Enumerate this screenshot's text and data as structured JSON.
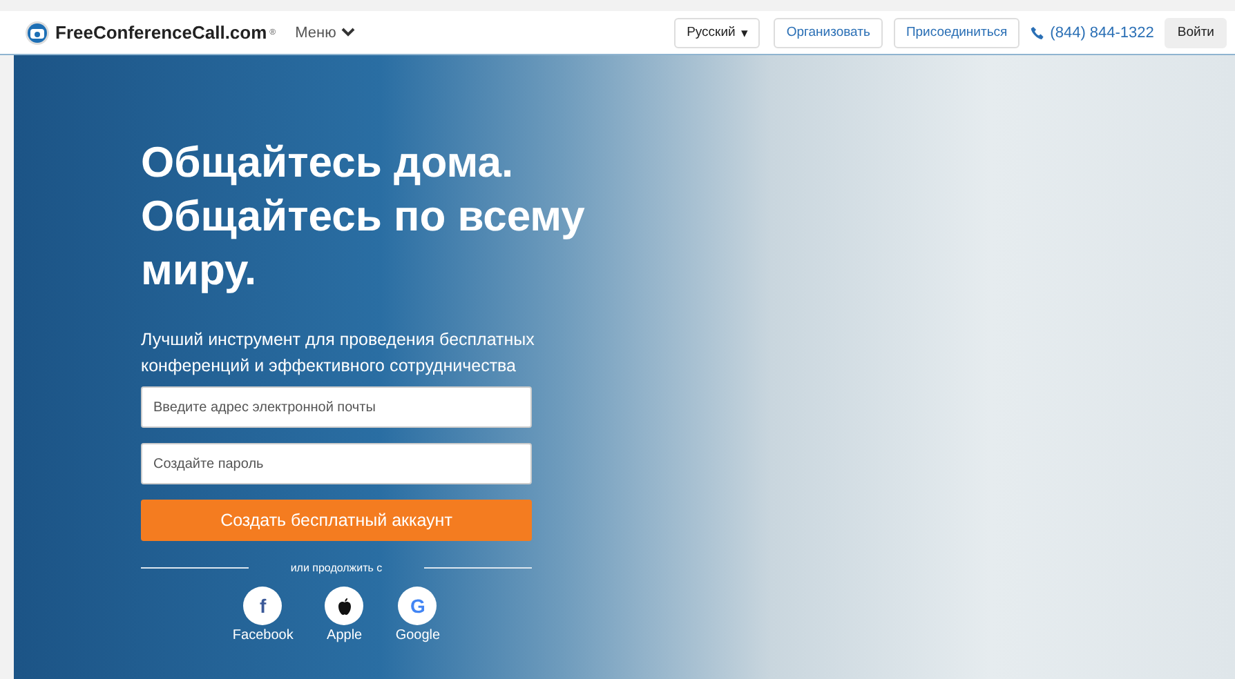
{
  "header": {
    "logo": "FreeConferenceCall.com",
    "logo_mark": "®",
    "menu": "Меню",
    "language": "Русский",
    "language_caret": "▾",
    "host": "Организовать",
    "join": "Присоединиться",
    "phone": "(844) 844-1322",
    "login": "Войти"
  },
  "hero": {
    "headline": [
      "Общайтесь дома.",
      "Общайтесь по всему",
      "миру."
    ],
    "subtitle": "Лучший инструмент для проведения бесплатных конференций и эффективного сотрудничества",
    "email": {
      "placeholder": "Введите адрес электронной почты"
    },
    "password": {
      "placeholder": "Создайте пароль"
    },
    "submit": "Создать бесплатный аккаунт",
    "divider_text": "или продолжить с",
    "social": [
      {
        "kind": "letter",
        "glyph": "f",
        "color": "#3b5998",
        "label": "Facebook"
      },
      {
        "kind": "apple",
        "color": "#111111",
        "label": "Apple"
      },
      {
        "kind": "letter",
        "glyph": "G",
        "color": "#4285f4",
        "label": "Google"
      }
    ]
  }
}
